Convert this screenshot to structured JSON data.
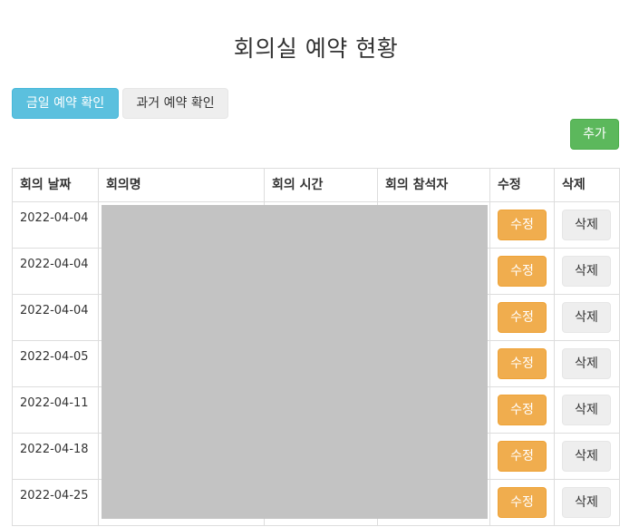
{
  "page": {
    "title": "회의실 예약 현황"
  },
  "tabs": {
    "today_label": "금일 예약 확인",
    "past_label": "과거 예약 확인"
  },
  "toolbar": {
    "add_label": "추가"
  },
  "table": {
    "headers": {
      "date": "회의 날짜",
      "name": "회의명",
      "time": "회의 시간",
      "attendees": "회의 참석자",
      "edit": "수정",
      "delete": "삭제"
    },
    "rows": [
      {
        "date": "2022-04-04",
        "edit_label": "수정",
        "delete_label": "삭제"
      },
      {
        "date": "2022-04-04",
        "edit_label": "수정",
        "delete_label": "삭제"
      },
      {
        "date": "2022-04-04",
        "edit_label": "수정",
        "delete_label": "삭제"
      },
      {
        "date": "2022-04-05",
        "edit_label": "수정",
        "delete_label": "삭제"
      },
      {
        "date": "2022-04-11",
        "edit_label": "수정",
        "delete_label": "삭제"
      },
      {
        "date": "2022-04-18",
        "edit_label": "수정",
        "delete_label": "삭제"
      },
      {
        "date": "2022-04-25",
        "edit_label": "수정",
        "delete_label": "삭제"
      }
    ]
  },
  "colors": {
    "info": "#5bc0de",
    "success": "#5cb85c",
    "warning": "#f0ad4e",
    "default": "#eeeeee",
    "redaction": "#c3c3c3"
  }
}
